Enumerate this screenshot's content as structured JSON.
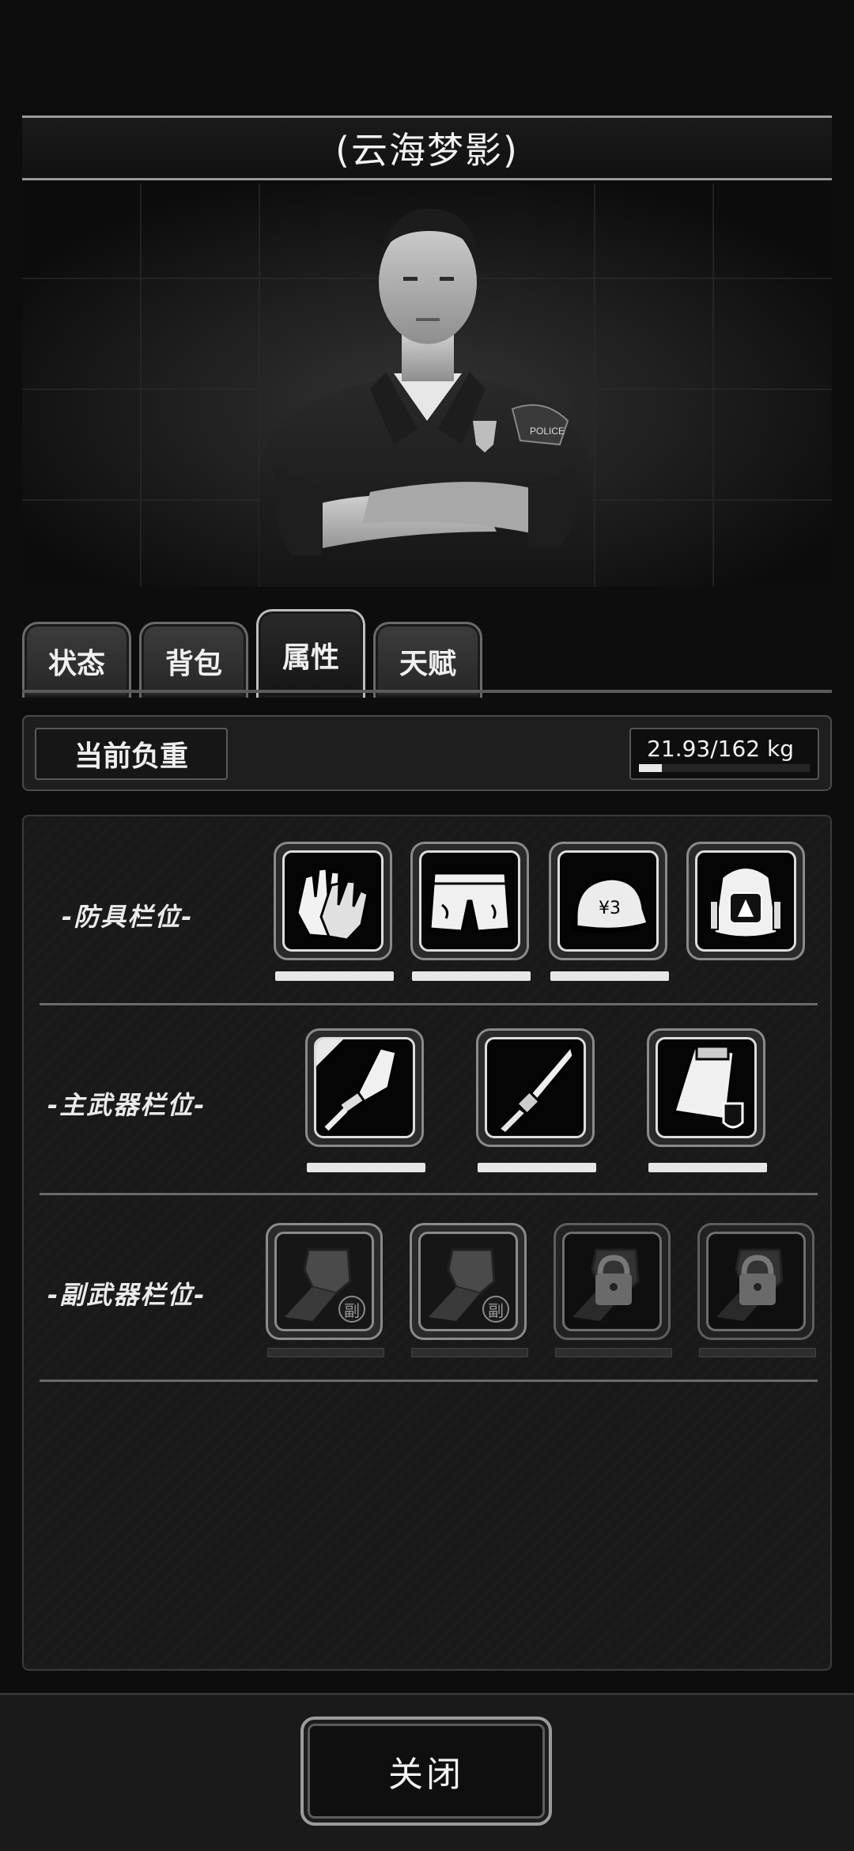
{
  "title": "(云海梦影)",
  "tabs": [
    {
      "label": "状态",
      "active": false
    },
    {
      "label": "背包",
      "active": false
    },
    {
      "label": "属性",
      "active": true
    },
    {
      "label": "天赋",
      "active": false
    }
  ],
  "weight": {
    "label": "当前负重",
    "text": "21.93/162 kg",
    "fraction": 0.135
  },
  "sections": {
    "armor": {
      "label": "-防具栏位-",
      "slots": [
        {
          "icon": "gloves-icon",
          "locked": false
        },
        {
          "icon": "shorts-icon",
          "locked": false
        },
        {
          "icon": "cap-icon",
          "locked": false
        },
        {
          "icon": "backpack-icon",
          "locked": false
        }
      ]
    },
    "primary": {
      "label": "-主武器栏位-",
      "slots": [
        {
          "icon": "blade-icon",
          "locked": false
        },
        {
          "icon": "knife-icon",
          "locked": false
        },
        {
          "icon": "box-icon",
          "locked": false
        }
      ]
    },
    "secondary": {
      "label": "-副武器栏位-",
      "badge": "副",
      "slots": [
        {
          "icon": "fist-icon",
          "locked": false
        },
        {
          "icon": "fist-icon",
          "locked": false
        },
        {
          "icon": "lock-icon",
          "locked": true
        },
        {
          "icon": "lock-icon",
          "locked": true
        }
      ]
    }
  },
  "close_label": "关闭"
}
